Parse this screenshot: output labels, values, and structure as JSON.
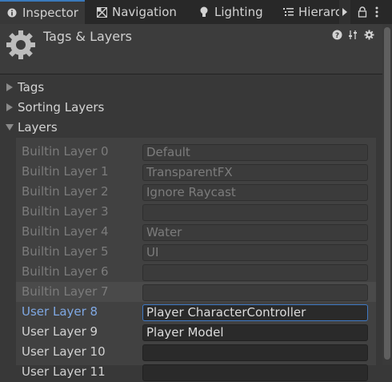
{
  "tabs": [
    {
      "label": "Inspector",
      "icon": "info-icon"
    },
    {
      "label": "Navigation",
      "icon": "navigation-icon"
    },
    {
      "label": "Lighting",
      "icon": "lightbulb-icon"
    },
    {
      "label": "Hierarc",
      "icon": "hierarchy-icon"
    }
  ],
  "header": {
    "title": "Tags & Layers"
  },
  "foldouts": {
    "tags": "Tags",
    "sorting_layers": "Sorting Layers",
    "layers": "Layers"
  },
  "layers": [
    {
      "label": "Builtin Layer 0",
      "value": "Default"
    },
    {
      "label": "Builtin Layer 1",
      "value": "TransparentFX"
    },
    {
      "label": "Builtin Layer 2",
      "value": "Ignore Raycast"
    },
    {
      "label": "Builtin Layer 3",
      "value": ""
    },
    {
      "label": "Builtin Layer 4",
      "value": "Water"
    },
    {
      "label": "Builtin Layer 5",
      "value": "UI"
    },
    {
      "label": "Builtin Layer 6",
      "value": ""
    },
    {
      "label": "Builtin Layer 7",
      "value": ""
    },
    {
      "label": "User Layer 8",
      "value": "Player CharacterController"
    },
    {
      "label": "User Layer 9",
      "value": "Player Model"
    },
    {
      "label": "User Layer 10",
      "value": ""
    },
    {
      "label": "User Layer 11",
      "value": ""
    }
  ],
  "colors": {
    "accent": "#3a79bb",
    "active_label": "#7fa8e3",
    "background": "#383838"
  }
}
